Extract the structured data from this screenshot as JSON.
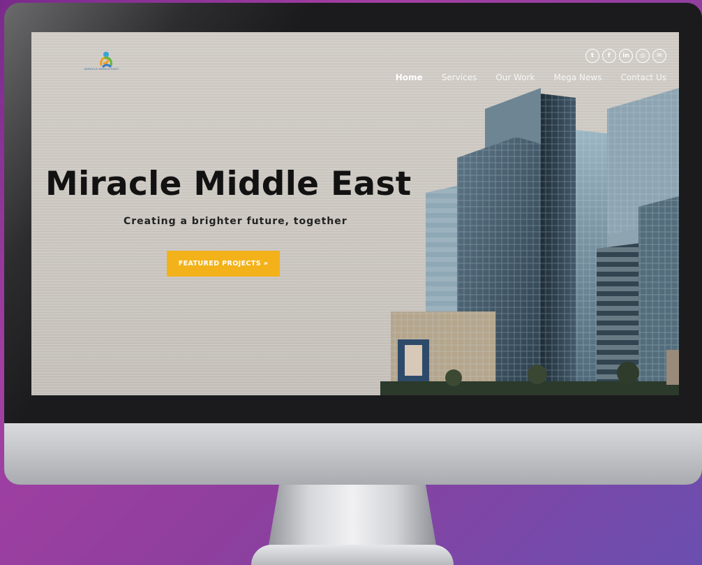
{
  "site": {
    "logo_text": "MIRACLE MIDDLE EAST"
  },
  "social_icons": [
    "twitter-icon",
    "facebook-icon",
    "linkedin-icon",
    "instagram-icon",
    "email-icon"
  ],
  "nav": {
    "items": [
      {
        "label": "Home",
        "active": true
      },
      {
        "label": "Services"
      },
      {
        "label": "Our Work"
      },
      {
        "label": "Mega News"
      },
      {
        "label": "Contact Us"
      }
    ]
  },
  "hero": {
    "title": "Miracle Middle East",
    "subtitle": "Creating a brighter future, together",
    "cta_label": "FEATURED PROJECTS »"
  },
  "colors": {
    "accent": "#f3b21a",
    "background": "#a33fa3"
  }
}
